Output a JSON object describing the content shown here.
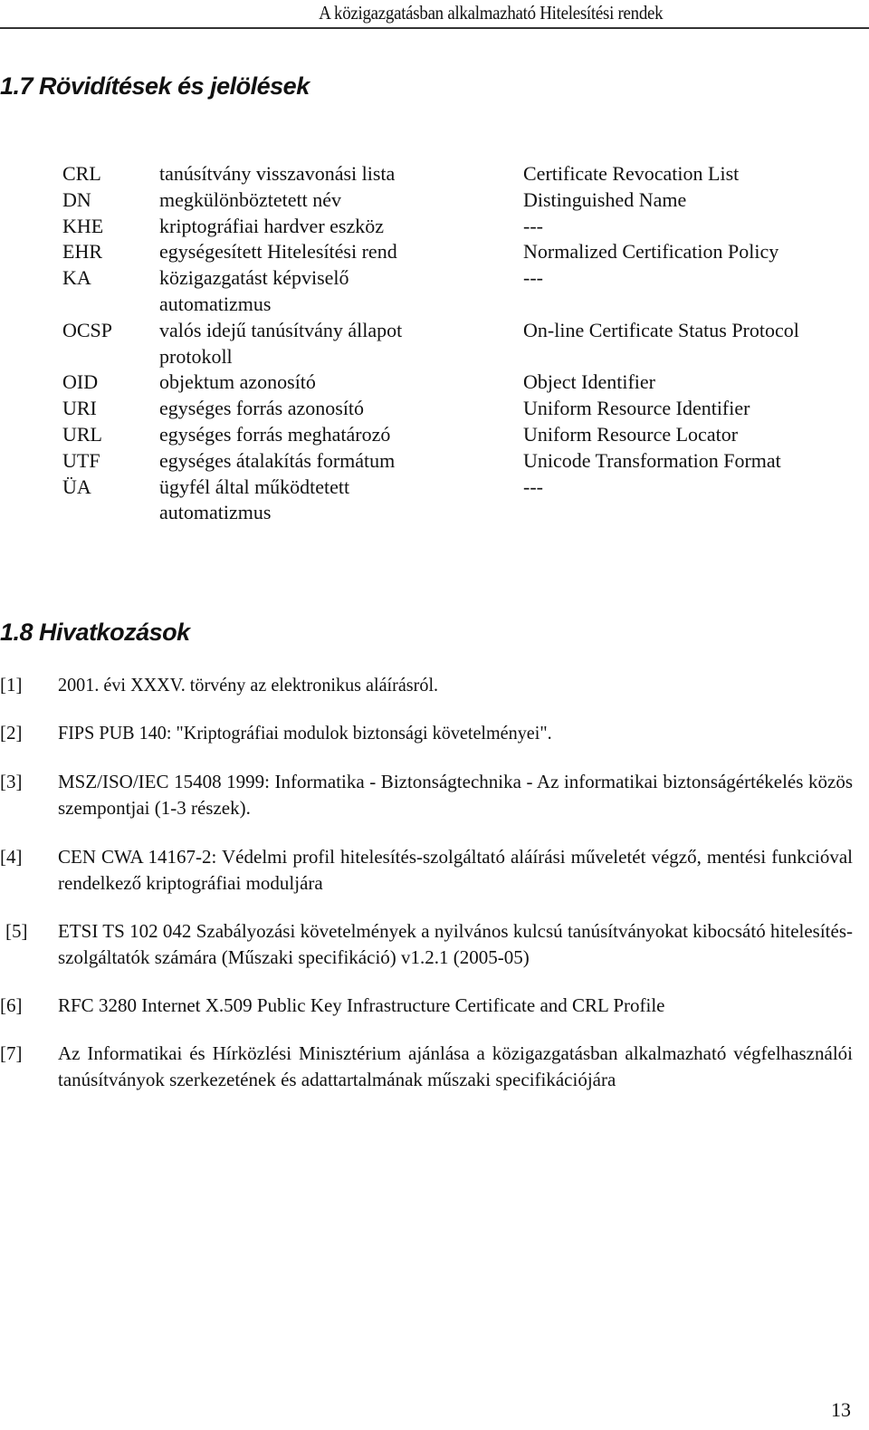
{
  "header": {
    "running_title": "A közigazgatásban alkalmazható Hitelesítési rendek"
  },
  "section_abbreviations": {
    "title": "1.7 Rövidítések és jelölések",
    "rows": [
      {
        "abbr": "CRL",
        "hungarian": "tanúsítvány visszavonási lista",
        "english": "Certificate Revocation List"
      },
      {
        "abbr": "DN",
        "hungarian": "megkülönböztetett név",
        "english": "Distinguished Name"
      },
      {
        "abbr": "KHE",
        "hungarian": "kriptográfiai hardver eszköz",
        "english": "---"
      },
      {
        "abbr": "EHR",
        "hungarian": "egységesített Hitelesítési rend",
        "english": "Normalized Certification Policy"
      },
      {
        "abbr": "KA",
        "hungarian": "közigazgatást képviselő automatizmus",
        "english": "---"
      },
      {
        "abbr": "OCSP",
        "hungarian": "valós idejű tanúsítvány állapot protokoll",
        "english": "On-line Certificate Status Protocol"
      },
      {
        "abbr": "OID",
        "hungarian": "objektum azonosító",
        "english": "Object Identifier"
      },
      {
        "abbr": "URI",
        "hungarian": "egységes forrás azonosító",
        "english": "Uniform Resource Identifier"
      },
      {
        "abbr": "URL",
        "hungarian": "egységes forrás meghatározó",
        "english": "Uniform Resource Locator"
      },
      {
        "abbr": "UTF",
        "hungarian": "egységes átalakítás formátum",
        "english": "Unicode Transformation Format"
      },
      {
        "abbr": "ÜA",
        "hungarian": "ügyfél által működtetett automatizmus",
        "english": "---"
      }
    ]
  },
  "section_references": {
    "title": "1.8 Hivatkozások",
    "items": [
      {
        "num": "[1]",
        "text": "2001. évi XXXV. törvény az elektronikus aláírásról."
      },
      {
        "num": "[2]",
        "text": "FIPS PUB 140: \"Kriptográfiai modulok biztonsági követelményei\"."
      },
      {
        "num": "[3]",
        "text": "MSZ/ISO/IEC 15408 1999: Informatika - Biztonságtechnika - Az informatikai biztonságértékelés közös szempontjai (1-3 részek)."
      },
      {
        "num": "[4]",
        "text": "CEN CWA 14167-2: Védelmi profil hitelesítés-szolgáltató aláírási műveletét végző, mentési funkcióval rendelkező kriptográfiai moduljára"
      },
      {
        "num": "[5]",
        "text": "ETSI TS 102 042 Szabályozási követelmények a nyilvános kulcsú tanúsítványokat kibocsátó hitelesítés-szolgáltatók számára (Műszaki specifikáció) v1.2.1 (2005-05)"
      },
      {
        "num": "[6]",
        "text": "RFC 3280 Internet X.509 Public Key Infrastructure Certificate and CRL Profile"
      },
      {
        "num": "[7]",
        "text": "Az Informatikai és Hírközlési Minisztérium ajánlása a közigazgatásban alkalmazható végfelhasználói tanúsítványok szerkezetének és adattartalmának műszaki specifikációjára"
      }
    ]
  },
  "footer": {
    "page_number": "13"
  }
}
